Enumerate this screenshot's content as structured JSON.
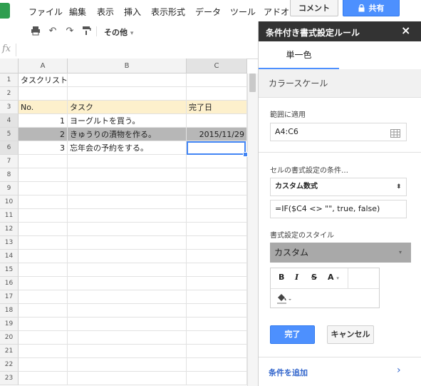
{
  "menubar": {
    "items": [
      "ファイル",
      "編集",
      "表示",
      "挿入",
      "表示形式",
      "データ",
      "ツール",
      "アドオン"
    ],
    "comment_label": "コメント",
    "share_label": "共有",
    "share_icon": "lock-icon"
  },
  "toolbar": {
    "more_label": "その他",
    "icons": [
      "print-icon",
      "undo-icon",
      "redo-icon",
      "paint-format-icon"
    ]
  },
  "formula_bar": {
    "fx": "fx",
    "value": ""
  },
  "grid": {
    "columns": [
      "A",
      "B",
      "C"
    ],
    "rows": [
      "1",
      "2",
      "3",
      "4",
      "5",
      "6",
      "7",
      "8",
      "9",
      "10",
      "11",
      "12",
      "13",
      "14",
      "15",
      "16",
      "17",
      "18",
      "19",
      "20",
      "21",
      "22",
      "23"
    ],
    "cells": {
      "a1": "タスクリスト",
      "a3": "No.",
      "b3": "タスク",
      "c3": "完了日",
      "a4": "1",
      "b4": "ヨーグルトを買う。",
      "c4": "",
      "a5": "2",
      "b5": "きゅうりの漬物を作る。",
      "c5": "2015/11/29",
      "a6": "3",
      "b6": "忘年会の予約をする。",
      "c6": ""
    },
    "header_fill": "#fdf0cc",
    "highlight_fill": "#b7b7b7"
  },
  "panel": {
    "title": "条件付き書式設定ルール",
    "close": "×",
    "tab_single": "単一色",
    "tab_scale": "カラースケール",
    "range_label": "範囲に適用",
    "range_value": "A4:C6",
    "condition_label": "セルの書式設定の条件…",
    "condition_value": "カスタム数式",
    "formula_value": "=IF($C4 <> \"\", true, false)",
    "style_label": "書式設定のスタイル",
    "style_value": "カスタム",
    "done_label": "完了",
    "cancel_label": "キャンセル",
    "add_condition_label": "条件を追加"
  },
  "colors": {
    "accent": "#4d90fe",
    "panel_header": "#333333",
    "highlight": "#b7b7b7"
  }
}
